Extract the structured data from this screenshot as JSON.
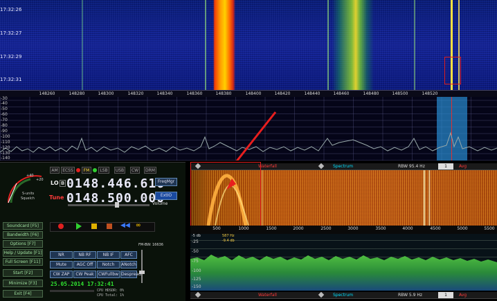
{
  "colors": {
    "accent_red": "#ff2020",
    "waterfall_blue": "#15259a",
    "bar_text": "#00e0ff",
    "red_text": "#ff3a3a"
  },
  "top_waterfall": {
    "timestamps": [
      "17:32:26",
      "17:32:27",
      "17:32:29",
      "17:32:31"
    ]
  },
  "top_axis": {
    "freqs": [
      "148260",
      "148280",
      "148300",
      "148320",
      "148340",
      "148360",
      "148380",
      "148400",
      "148420",
      "148440",
      "148460",
      "148480",
      "148500",
      "148520"
    ]
  },
  "top_spectrum": {
    "db_labels": [
      "-30",
      "-40",
      "-50",
      "-60",
      "-70",
      "-80",
      "-90",
      "-100",
      "-110",
      "-120",
      "-130",
      "-140"
    ]
  },
  "modes": [
    "AM",
    "ECSS",
    "FM",
    "LSB",
    "USB",
    "CW",
    "DRM"
  ],
  "radio": {
    "lo_label": "LO",
    "lo_b": "B",
    "lo_freq": "0148.446.616",
    "tune_label": "Tune",
    "tune_freq": "0148.500.000",
    "volume_label": "Volume",
    "freqmgr": "FreqMgr",
    "exit_io": "ExtIO",
    "s_units": "S-units",
    "squelch": "Squelch"
  },
  "left_buttons": [
    "Soundcard [F5]",
    "Bandwidth [F6]",
    "Options [F7]",
    "Help / Update [F1]",
    "Full Screen [F11]",
    "Start [F2]",
    "Minimize [F3]",
    "Exit [F4]"
  ],
  "fm_bw": "FM-BW: 16636",
  "dsp_buttons": [
    "NR",
    "NB RF",
    "NB IF",
    "AFC",
    "Mute",
    "AGC Off",
    "Notch",
    "ANotch",
    "CW ZAP",
    "CW Peak",
    "CWFullbw",
    "Despread"
  ],
  "status": {
    "datetime": "25.05.2014 17:32:41",
    "cpu_hdsdr": "CPU HDSDR: 0%",
    "cpu_total": "CPU Total: 1%"
  },
  "right_top_bar": {
    "waterfall": "Waterfall",
    "spectrum": "Spectrum",
    "rbw": "RBW 95.4 Hz",
    "avg": "Avg",
    "avg_val": "1"
  },
  "right_bottom_bar": {
    "waterfall": "Waterfall",
    "spectrum": "Spectrum",
    "rbw": "RBW 5.9 Hz",
    "avg": "Avg",
    "avg_val": "1"
  },
  "right_axis": {
    "freqs": [
      "500",
      "1000",
      "1500",
      "2000",
      "2500",
      "3000",
      "3500",
      "4000",
      "4500",
      "5000",
      "5500"
    ]
  },
  "right_spectrum": {
    "db_labels": [
      "-25",
      "-50",
      "-75",
      "-100",
      "-125",
      "-150"
    ],
    "marker_hz": "587 Hz",
    "marker_db": "-9.4 db",
    "corner": "-5 db"
  }
}
